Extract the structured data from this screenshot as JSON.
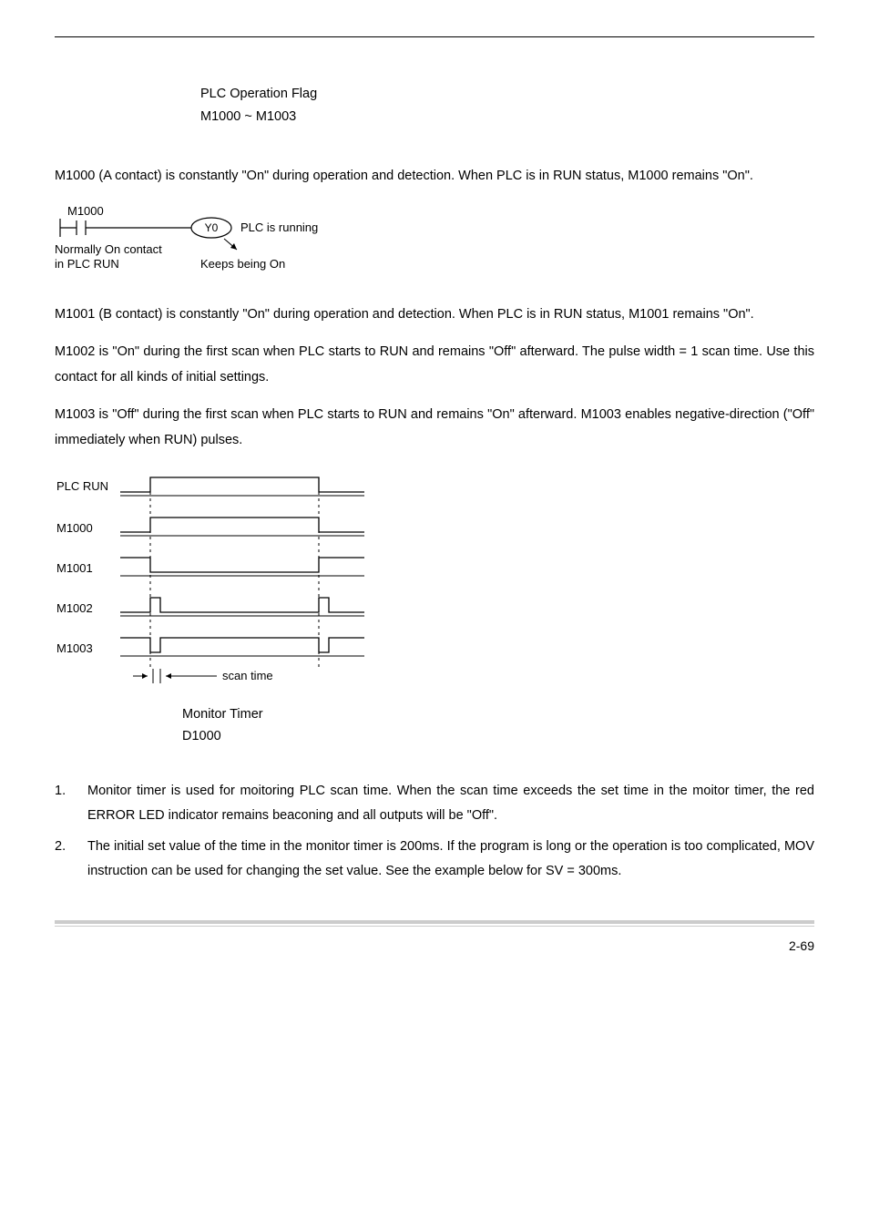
{
  "section1": {
    "title_l1": "PLC Operation Flag",
    "title_l2": "M1000 ~ M1003",
    "m1000_para": "M1000 (A contact) is constantly \"On\" during operation and detection. When PLC is in RUN status, M1000 remains \"On\".",
    "ladder": {
      "coil_relay": "M1000",
      "output_label": "Y0",
      "right_label": "PLC is running",
      "bottom_left_1": "Normally On contact",
      "bottom_left_2": "in PLC RUN",
      "bottom_right": "Keeps being On"
    },
    "m1001_para": "M1001 (B contact) is constantly \"On\" during operation and detection. When PLC is in RUN status, M1001 remains \"On\".",
    "m1002_para": "M1002 is \"On\" during the first scan when PLC starts to RUN and remains \"Off\" afterward. The pulse width = 1 scan time. Use this contact for all kinds of initial settings.",
    "m1003_para": "M1003 is \"Off\" during the first scan when PLC starts to RUN and remains \"On\" afterward. M1003 enables negative-direction (\"Off\" immediately when RUN) pulses."
  },
  "timing": {
    "labels": [
      "PLC RUN",
      "M1000",
      "M1001",
      "M1002",
      "M1003"
    ],
    "scan_label": "scan time"
  },
  "section2": {
    "title_l1": "Monitor Timer",
    "title_l2": "D1000",
    "items": [
      "Monitor timer is used for moitoring PLC scan time. When the scan time exceeds the set time in the moitor timer, the red ERROR LED indicator remains beaconing and all outputs will be \"Off\".",
      "The initial set value of the time in the monitor timer is 200ms. If the program is long or the operation is too complicated, MOV instruction can be used for changing the set value. See the example below for SV = 300ms."
    ]
  },
  "page_number": "2-69"
}
